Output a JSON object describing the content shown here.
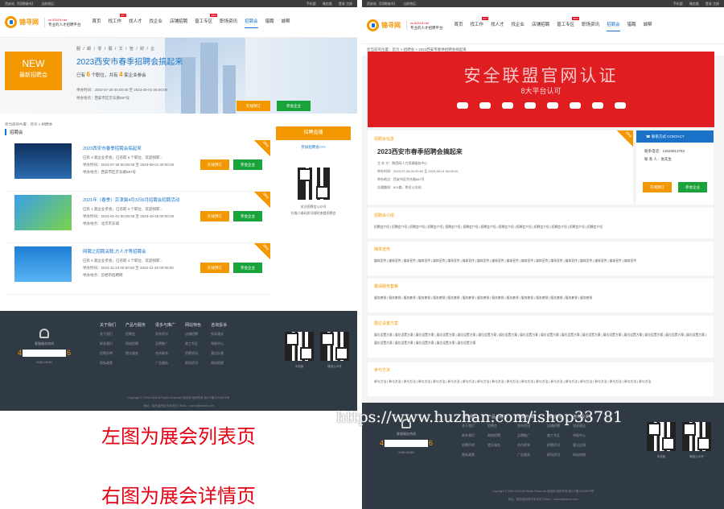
{
  "common": {
    "topbar": {
      "location": "西安站 【切换城市】",
      "current": "当前地区：",
      "phone": "手机版",
      "wechat": "微信版",
      "loginreg": "登录 注册",
      "entry": "进入用户中心 | 企业会员中心 | 网站导航"
    },
    "logo": {
      "name": "锦寻网",
      "domain": "zc.52419.net",
      "slogan": "专业的人才招聘平台"
    },
    "menu": [
      {
        "label": "首页",
        "hot": ""
      },
      {
        "label": "找工作",
        "hot": "HOT"
      },
      {
        "label": "找人才",
        "hot": ""
      },
      {
        "label": "找企业",
        "hot": ""
      },
      {
        "label": "店铺招聘",
        "hot": ""
      },
      {
        "label": "普工专区",
        "hot": "NEW"
      },
      {
        "label": "职场资讯",
        "hot": ""
      },
      {
        "label": "招聘会",
        "hot": ""
      },
      {
        "label": "猎聘",
        "hot": ""
      },
      {
        "label": "城帮",
        "hot": ""
      }
    ],
    "footer": {
      "hotline_label": "客服服务热线",
      "phone_start": "4",
      "phone_end": "6",
      "hours": "9:00-24:00",
      "columns": [
        {
          "title": "关于我们",
          "links": [
            "关于我们",
            "联系我们",
            "招聘声明",
            "隐私政策"
          ]
        },
        {
          "title": "产品与服务",
          "links": [
            "招聘会",
            "网络招聘",
            "猎头服务"
          ]
        },
        {
          "title": "很多与推广",
          "links": [
            "发布资讯",
            "品牌推广",
            "合作联系",
            "广告服务"
          ]
        },
        {
          "title": "网站特色",
          "links": [
            "店铺招聘",
            "普工专区",
            "招聘资讯",
            "职场资讯"
          ]
        },
        {
          "title": "咨询投诉",
          "links": [
            "投诉建议",
            "举报中心",
            "意见反馈",
            "网站地图"
          ]
        }
      ],
      "qr": [
        {
          "caption": "手机版"
        },
        {
          "caption": "微信公众号"
        }
      ],
      "copyright": "Copyright © 2009-2018 All Rights Reserved 锦寻网 版权所有 陕ICP备12345678号",
      "address": "地址：陕西省西安市未央区 EMAIL：admin@admin.com"
    }
  },
  "list_page": {
    "hero": {
      "new_title": "NEW",
      "new_sub": "最新招聘会",
      "cats": "服 / 邮 / 零 / 展 / 文 / 管 / 财 / 企",
      "title": "2023西安市春季招聘会搞起来",
      "stats_pre": "已有",
      "booths": "6",
      "stats_mid": "个职位，共有",
      "companies": "4",
      "stats_post": "家企业参会",
      "time_label": "举办时间：",
      "time": "2023-07-28 00:00:00 至 2023-09-01 00:00:00",
      "addr_label": "举办地点：",
      "addr": "西安市区京东路687号",
      "btn_book": "在线预订",
      "btn_join": "参会企业"
    },
    "breadcrumb": "您当前的位置：首页 > 招聘会",
    "list_title": "招聘会",
    "items": [
      {
        "name": "2023西安市春季招聘会搞起来",
        "stats": "已有 4 家企业参会，已有职 6 个职位，欢迎找职...",
        "time": "举办时间：2023-07-28 00:00:00 至 2023-09-01 00:00:00",
        "addr": "举办地点：西安市区京东路687号",
        "ribbon": "招聘会",
        "btn_book": "在线预订",
        "btn_join": "参会企业"
      },
      {
        "name": "2021年（春季）京津冀4月3日6月招聘会招聘活动",
        "stats": "已有 1 家企业参会，已有职 0 个职位，欢迎找职...",
        "time": "举办时间：2023-01-01 00:00:00 至 2023-10-26 00:00:00",
        "addr": "举办地点：北京市东城",
        "ribbon": "招聘会",
        "btn_book": "在线预订",
        "btn_join": "参会企业"
      },
      {
        "name": "网聘之招聘关联,方人才等招聘会",
        "stats": "已有 5 家企业参会，已有职 4 个职位，欢迎找职...",
        "time": "举办时间：2023-11-24 00:00:00 至 2023-12-29 00:00:00",
        "addr": "举办地点：云栖市招聘网",
        "ribbon": "招聘会",
        "btn_book": "在线预订",
        "btn_join": "参会企业"
      }
    ],
    "side": {
      "head": "招聘直播",
      "link": "参加招聘会>>>",
      "qr_caption1": "关注招聘会公众号",
      "qr_caption2": "扫描二维码即可随时查看招聘会"
    },
    "caption": "左图为展会列表页"
  },
  "detail_page": {
    "breadcrumb": "您当前的位置：首页 > 招聘会 > 2023西安市春季招聘会搞起来",
    "banner_title": "安全联盟官网认证",
    "banner_sub": "8大平台认可",
    "info": {
      "head": "招聘会信息",
      "title": "2023西安市春季招聘会搞起来",
      "lines": [
        "主 办 方：陕西网人力资源服务中心",
        "举办时间：2023-07-28 00:00:00 至 2023-09-01 00:00:00",
        "举办地点：西安市区京东路687号",
        "交通路线：601路，附近公交站"
      ],
      "ribbon": "招聘会"
    },
    "contact": {
      "head": "联系方式 CONTACT",
      "phone": "联系电话：13020813783",
      "person": "联 系 人：张先生",
      "btn_book": "在线预订",
      "btn_join": "参会企业"
    },
    "sections": [
      {
        "title": "招聘会介绍",
        "body": "招聘会介绍 | 招聘会介绍 | 招聘会介绍 | 招聘会介绍 | 招聘会介绍 | 招聘会介绍 | 招聘会介绍 | 招聘会介绍 | 招聘会介绍 | 招聘会介绍 | 招聘会介绍 | 招聘会介绍 | 招聘会介绍"
      },
      {
        "title": "媒体宣传",
        "body": "媒体宣传 | 媒体宣传 | 媒体宣传 | 媒体宣传 | 媒体宣传 | 媒体宣传 | 媒体宣传 | 媒体宣传 | 媒体宣传 | 媒体宣传 | 媒体宣传 | 媒体宣传 | 媒体宣传 | 媒体宣传 | 媒体宣传 | 媒体宣传 | 媒体宣传 | 媒体宣传"
      },
      {
        "title": "邀请服务套餐",
        "body": "服务套餐 | 服务套餐 | 服务套餐 | 服务套餐 | 服务套餐 | 服务套餐 | 服务套餐 | 服务套餐 | 服务套餐 | 服务套餐 | 服务套餐 | 服务套餐 | 服务套餐 | 服务套餐 | 服务套餐"
      },
      {
        "title": "展位设置方案",
        "body": "展位设置方案 | 展位设置方案 | 展位设置方案 | 展位设置方案 | 展位设置方案 | 展位设置方案 | 展位设置方案 | 展位设置方案 | 展位设置方案 | 展位设置方案 | 展位设置方案 | 展位设置方案 | 展位设置方案 | 展位设置方案 | 展位设置方案 | 展位设置方案 | 展位设置方案 | 展位设置方案 | 展位设置方案 | 展位设置方案 | 展位设置方案"
      },
      {
        "title": "参与方法",
        "body": "参与方法 | 参与方法 | 参与方法 | 参与方法 | 参与方法 | 参与方法 | 参与方法 | 参与方法 | 参与方法 | 参与方法 | 参与方法 | 参与方法 | 参与方法 | 参与方法 | 参与方法 | 参与方法 | 参与方法 | 参与方法 | 参与方法"
      }
    ],
    "caption": "右图为展会详情页"
  },
  "watermark": "https://www.huzhan.com/ishop33781"
}
